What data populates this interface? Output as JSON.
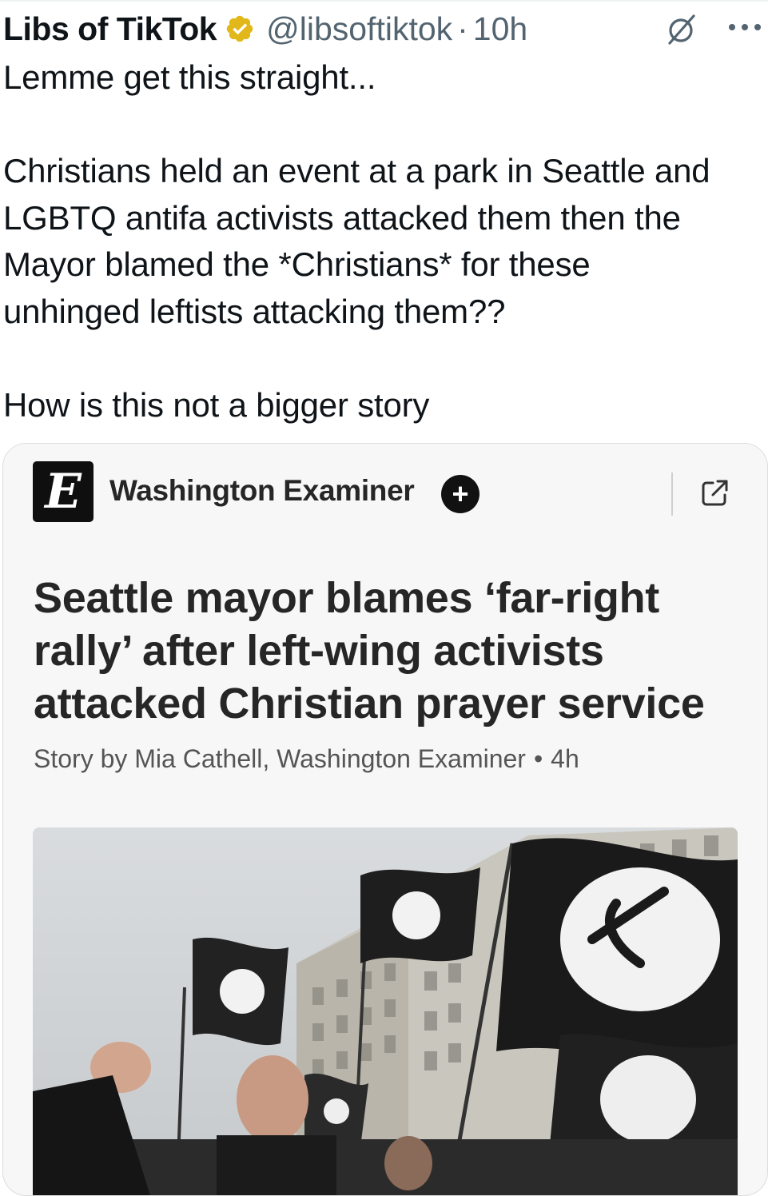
{
  "tweet": {
    "author_name": "Libs of TikTok",
    "handle": "@libsoftiktok",
    "separator": "·",
    "time": "10h",
    "text_lines": [
      "Lemme get this straight...",
      "",
      "Christians held an event at a park in Seattle and",
      "LGBTQ antifa activists attacked them then the",
      "Mayor blamed the *Christians* for these",
      "unhinged leftists attacking them??",
      "",
      "How is this not a bigger story"
    ],
    "verified_color": "#e2b719"
  },
  "card": {
    "publisher": "Washington Examiner",
    "logo_letter": "E",
    "follow_label": "+",
    "headline_lines": [
      "Seattle mayor blames ‘far-right",
      "rally’ after left-wing activists",
      "attacked Christian prayer service"
    ],
    "byline": "Story by Mia Cathell, Washington Examiner",
    "bullet": "•",
    "age": "4h"
  },
  "icons": {
    "verified": "verified-badge-icon",
    "grok": "grok-icon",
    "more": "more-options-icon",
    "external": "external-link-icon"
  }
}
